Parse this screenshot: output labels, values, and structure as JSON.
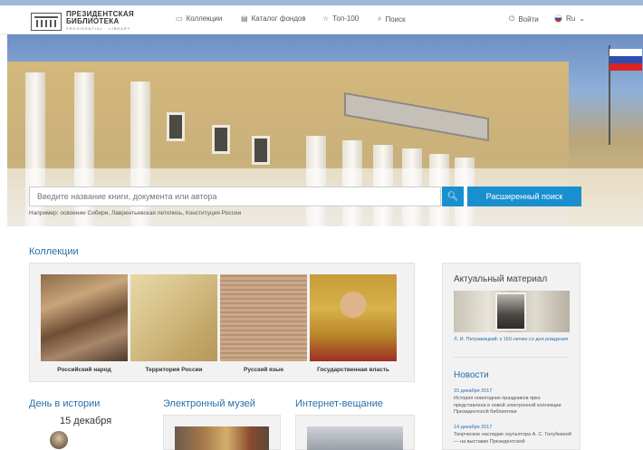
{
  "header": {
    "logo": {
      "line1": "ПРЕЗИДЕНТСКАЯ",
      "line2": "БИБЛИОТЕКА",
      "line3": "PRESIDENTIAL · LIBRARY"
    },
    "nav": [
      {
        "label": "Коллекции",
        "icon": "book-icon"
      },
      {
        "label": "Каталог фондов",
        "icon": "catalog-icon"
      },
      {
        "label": "Топ-100",
        "icon": "star-icon"
      },
      {
        "label": "Поиск",
        "icon": "search-icon"
      }
    ],
    "login_label": "Войти",
    "language": "Ru"
  },
  "hero": {
    "search_placeholder": "Введите название книги, документа или автора",
    "advanced_search_label": "Расширенный поиск",
    "example_text": "Например: освоение Сибири, Лаврентьевская летопись, Конституция России"
  },
  "collections": {
    "title": "Коллекции",
    "items": [
      {
        "caption": "Российский народ"
      },
      {
        "caption": "Территория России"
      },
      {
        "caption": "Русский язык"
      },
      {
        "caption": "Государственная власть"
      }
    ]
  },
  "sidebar": {
    "current_title": "Актуальный материал",
    "current_caption": "Л. И. Петражицкий: к 150-летию со дня рождения",
    "news_title": "Новости",
    "news": [
      {
        "date": "15 декабря 2017",
        "text": "История новогодних праздников ярко представлена в новой электронной коллекции Президентской библиотеки"
      },
      {
        "date": "14 декабря 2017",
        "text": "Творческое наследие скульптора А. С. Голубкиной — на выставке Президентской"
      }
    ]
  },
  "bottom": {
    "day_title": "День в истории",
    "day_date": "15 декабря",
    "museum_title": "Электронный музей",
    "broadcast_title": "Интернет-вещание"
  },
  "colors": {
    "accent": "#1a8fd0",
    "link": "#2a6fa8"
  }
}
